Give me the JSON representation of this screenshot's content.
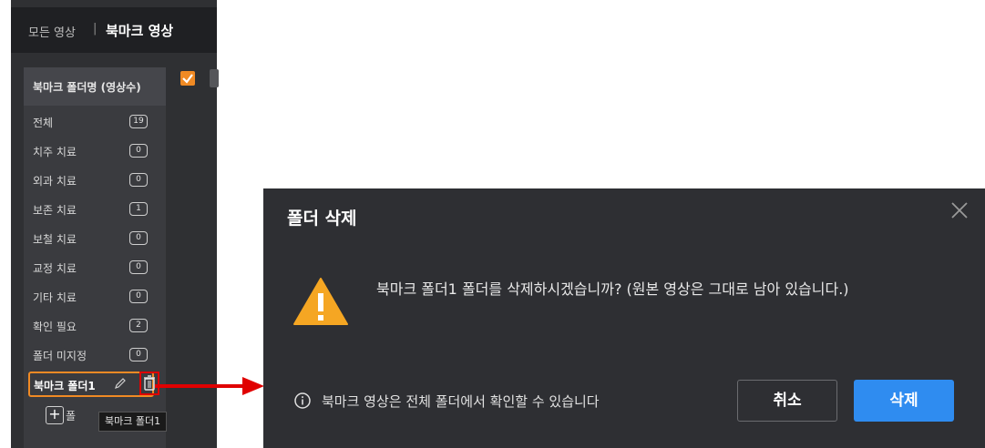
{
  "topbar": {
    "all_videos": "모든 영상",
    "separator": "|",
    "bookmark_videos": "북마크 영상"
  },
  "folder_panel": {
    "header": "북마크 폴더명 (영상수)",
    "items": [
      {
        "name": "전체",
        "count": "19"
      },
      {
        "name": "치주 치료",
        "count": "0"
      },
      {
        "name": "외과 치료",
        "count": "0"
      },
      {
        "name": "보존 치료",
        "count": "1"
      },
      {
        "name": "보철 치료",
        "count": "0"
      },
      {
        "name": "교정 치료",
        "count": "0"
      },
      {
        "name": "기타 치료",
        "count": "0"
      },
      {
        "name": "확인 필요",
        "count": "2"
      },
      {
        "name": "폴더 미지정",
        "count": "0"
      }
    ],
    "selected": {
      "name": "북마크 폴더1"
    },
    "add_label": "폴",
    "tooltip": "북마크 폴더1"
  },
  "dialog": {
    "title": "폴더 삭제",
    "message": "북마크 폴더1 폴더를 삭제하시겠습니까? (원본 영상은 그대로 남아 있습니다.)",
    "info": "북마크 영상은 전체 폴더에서 확인할 수 있습니다",
    "cancel": "취소",
    "delete": "삭제"
  },
  "colors": {
    "accent": "#f08a24",
    "primary": "#2f8cf0",
    "highlight": "#e00000",
    "warning": "#f5a623"
  }
}
